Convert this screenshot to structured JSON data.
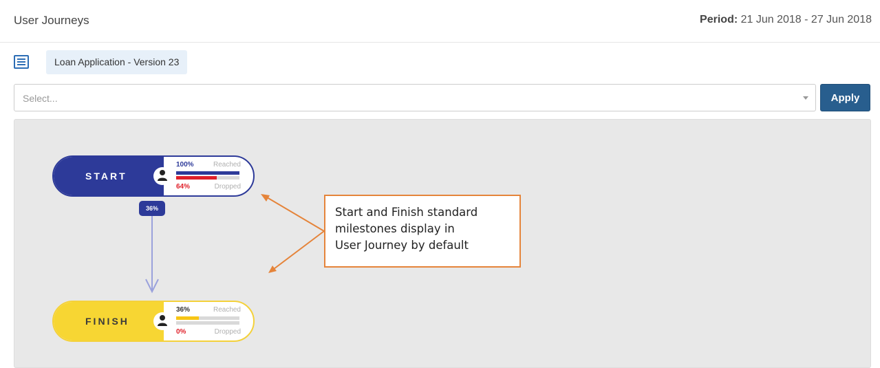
{
  "header": {
    "title": "User Journeys",
    "period_label": "Period:",
    "period_value": "21 Jun 2018 - 27 Jun 2018"
  },
  "toolbar": {
    "journey_chip": "Loan Application - Version 23",
    "list_icon": "list-icon"
  },
  "filter": {
    "placeholder": "Select...",
    "apply_label": "Apply"
  },
  "journey": {
    "start": {
      "label": "START",
      "reached_pct": "100%",
      "reached_label": "Reached",
      "reached_fraction": 1.0,
      "dropped_pct": "64%",
      "dropped_label": "Dropped",
      "dropped_fraction": 0.64,
      "color": "#2d3a99"
    },
    "connector_pct": "36%",
    "finish": {
      "label": "FINISH",
      "reached_pct": "36%",
      "reached_label": "Reached",
      "reached_fraction": 0.36,
      "dropped_pct": "0%",
      "dropped_label": "Dropped",
      "dropped_fraction": 0,
      "color": "#f7d633"
    }
  },
  "annotation": {
    "text_line1": "Start and Finish standard",
    "text_line2": "milestones display in",
    "text_line3": "User Journey by default",
    "color": "#e5843a"
  },
  "colors": {
    "accent_blue": "#2d3a99",
    "drop_red": "#e0202a",
    "finish_yellow": "#f7d633",
    "apply_button": "#285e8e"
  }
}
